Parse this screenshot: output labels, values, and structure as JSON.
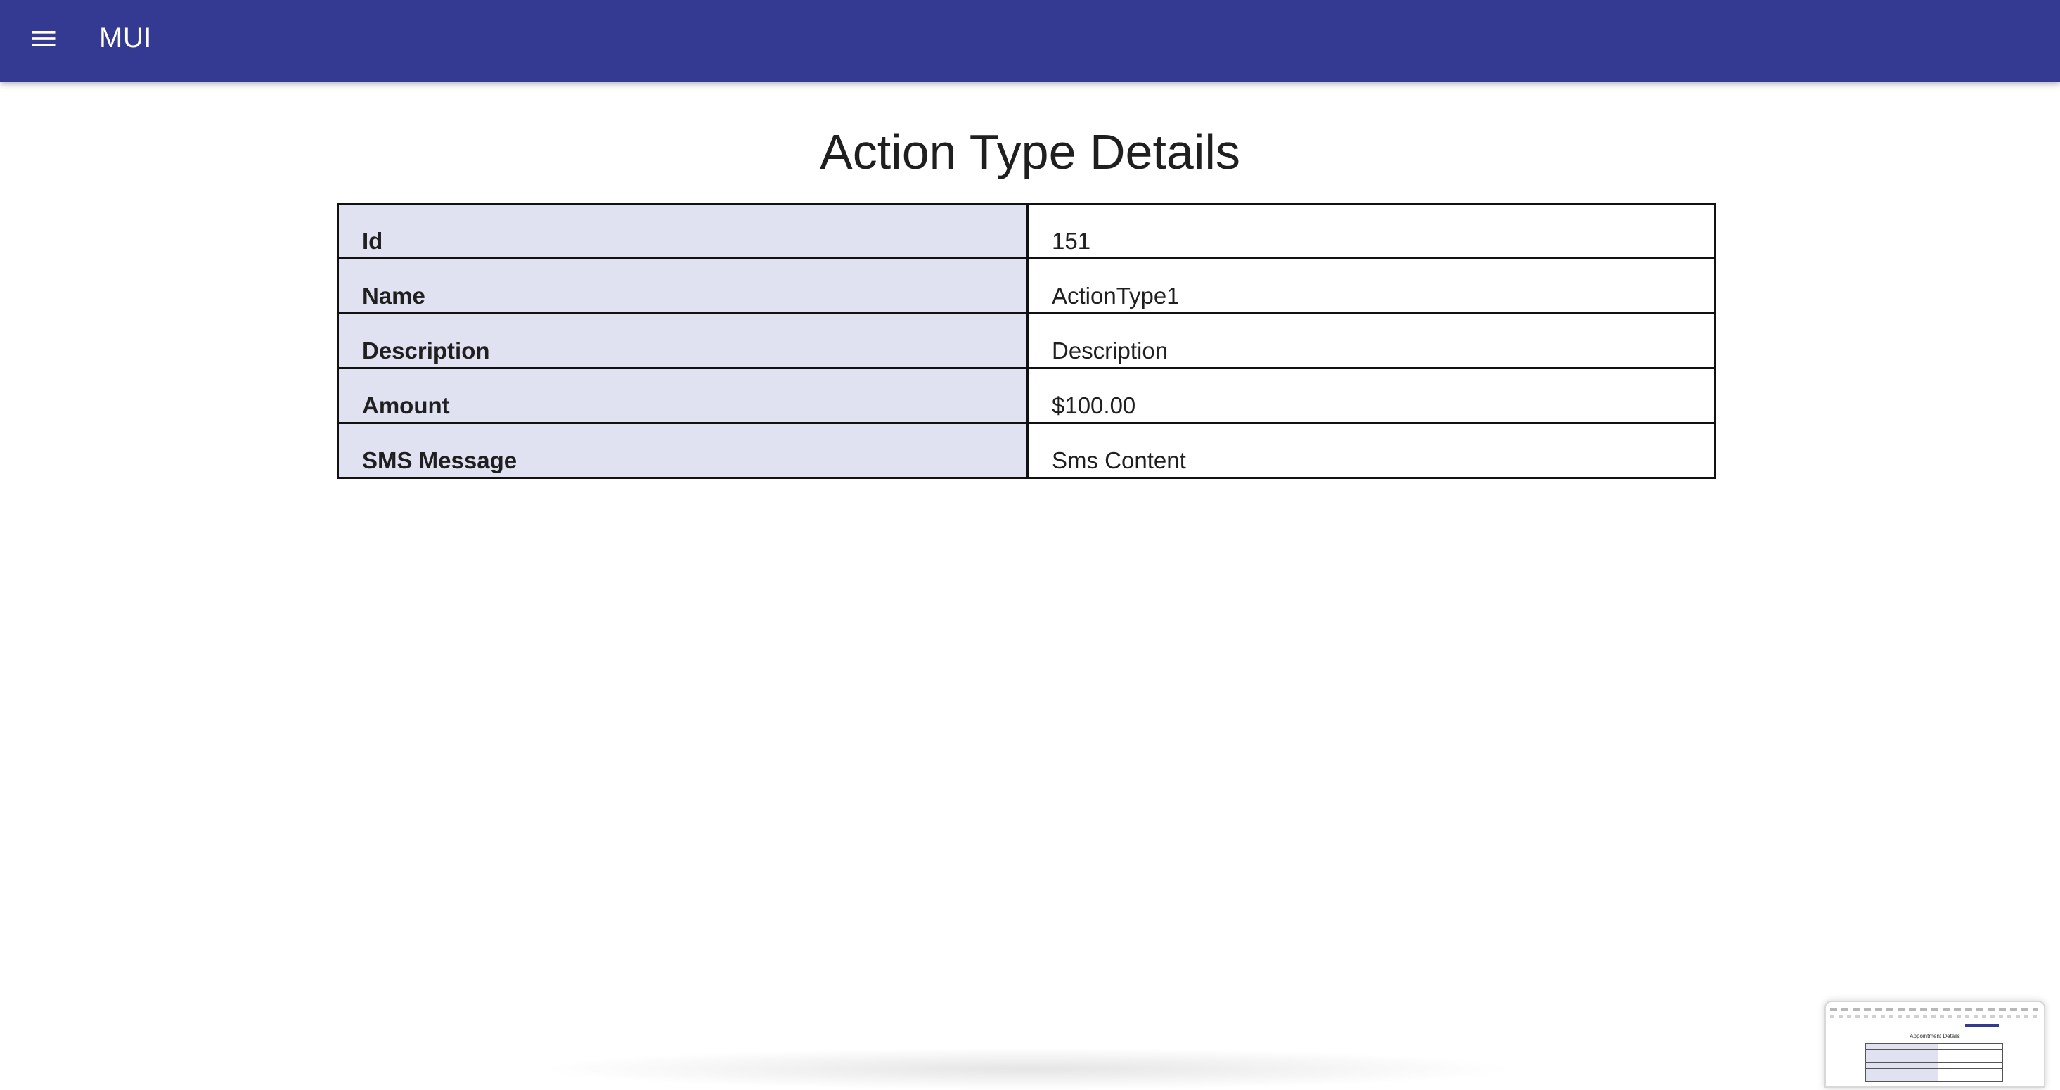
{
  "appbar": {
    "title": "MUI",
    "menu_icon": "hamburger-menu-icon",
    "color": "#343a91"
  },
  "page": {
    "title": "Action Type Details"
  },
  "details": {
    "rows": [
      {
        "label": "Id",
        "value": "151"
      },
      {
        "label": "Name",
        "value": "ActionType1"
      },
      {
        "label": "Description",
        "value": "Description"
      },
      {
        "label": "Amount",
        "value": "$100.00"
      },
      {
        "label": "SMS Message",
        "value": "Sms Content"
      }
    ],
    "label_bg": "#e0e2f1"
  },
  "thumbnail": {
    "title": "Appointment Details"
  }
}
